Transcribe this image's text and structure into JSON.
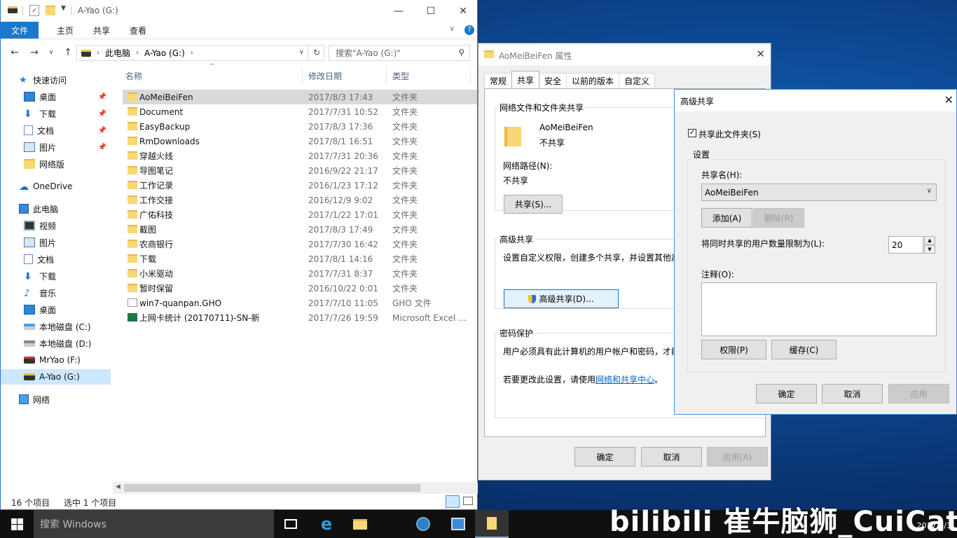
{
  "explorer": {
    "title": "A-Yao (G:)",
    "ribbon_tabs": [
      "文件",
      "主页",
      "共享",
      "查看"
    ],
    "address": {
      "pc": "此电脑",
      "drive": "A-Yao (G:)"
    },
    "search_placeholder": "搜索\"A-Yao (G:)\"",
    "columns": {
      "name": "名称",
      "date": "修改日期",
      "type": "类型"
    },
    "nav": [
      {
        "label": "快速访问",
        "icon": "star-icon",
        "pinned": false
      },
      {
        "label": "桌面",
        "icon": "desktop-icon",
        "pinned": true
      },
      {
        "label": "下载",
        "icon": "download-icon",
        "pinned": true
      },
      {
        "label": "文档",
        "icon": "document-icon",
        "pinned": true
      },
      {
        "label": "图片",
        "icon": "picture-icon",
        "pinned": true
      },
      {
        "label": "网络版",
        "icon": "folder-icon",
        "pinned": false
      },
      {
        "label": "OneDrive",
        "icon": "cloud-icon",
        "pinned": false
      },
      {
        "label": "此电脑",
        "icon": "computer-icon",
        "pinned": false
      },
      {
        "label": "视频",
        "icon": "video-icon",
        "pinned": false
      },
      {
        "label": "图片",
        "icon": "picture-icon",
        "pinned": false
      },
      {
        "label": "文档",
        "icon": "document-icon",
        "pinned": false
      },
      {
        "label": "下载",
        "icon": "download-icon",
        "pinned": false
      },
      {
        "label": "音乐",
        "icon": "music-icon",
        "pinned": false
      },
      {
        "label": "桌面",
        "icon": "desktop-icon",
        "pinned": false
      },
      {
        "label": "本地磁盘 (C:)",
        "icon": "drive-icon",
        "pinned": false
      },
      {
        "label": "本地磁盘 (D:)",
        "icon": "drive-icon",
        "pinned": false
      },
      {
        "label": "MrYao (F:)",
        "icon": "drive-icon",
        "pinned": false
      },
      {
        "label": "A-Yao (G:)",
        "icon": "drive-icon",
        "pinned": false
      },
      {
        "label": "网络",
        "icon": "network-icon",
        "pinned": false
      }
    ],
    "files": [
      {
        "name": "AoMeiBeiFen",
        "date": "2017/8/3 17:43",
        "type": "文件夹",
        "kind": "folder"
      },
      {
        "name": "Document",
        "date": "2017/7/31 10:52",
        "type": "文件夹",
        "kind": "folder"
      },
      {
        "name": "EasyBackup",
        "date": "2017/8/3 17:36",
        "type": "文件夹",
        "kind": "folder"
      },
      {
        "name": "RmDownloads",
        "date": "2017/8/1 16:51",
        "type": "文件夹",
        "kind": "folder"
      },
      {
        "name": "穿越火线",
        "date": "2017/7/31 20:36",
        "type": "文件夹",
        "kind": "folder"
      },
      {
        "name": "导图笔记",
        "date": "2016/9/22 21:17",
        "type": "文件夹",
        "kind": "folder"
      },
      {
        "name": "工作记录",
        "date": "2016/1/23 17:12",
        "type": "文件夹",
        "kind": "folder"
      },
      {
        "name": "工作交接",
        "date": "2016/12/9 9:02",
        "type": "文件夹",
        "kind": "folder"
      },
      {
        "name": "广佑科技",
        "date": "2017/1/22 17:01",
        "type": "文件夹",
        "kind": "folder"
      },
      {
        "name": "截图",
        "date": "2017/8/3 17:49",
        "type": "文件夹",
        "kind": "folder"
      },
      {
        "name": "农商银行",
        "date": "2017/7/30 16:42",
        "type": "文件夹",
        "kind": "folder"
      },
      {
        "name": "下载",
        "date": "2017/8/1 14:16",
        "type": "文件夹",
        "kind": "folder"
      },
      {
        "name": "小米驱动",
        "date": "2017/7/31 8:37",
        "type": "文件夹",
        "kind": "folder"
      },
      {
        "name": "暂时保留",
        "date": "2016/10/22 0:01",
        "type": "文件夹",
        "kind": "folder"
      },
      {
        "name": "win7-quanpan.GHO",
        "date": "2017/7/10 11:05",
        "type": "GHO 文件",
        "kind": "file"
      },
      {
        "name": "上网卡统计 (20170711)-SN-新",
        "date": "2017/7/26 19:59",
        "type": "Microsoft Excel ...",
        "kind": "xls"
      }
    ],
    "status_count": "16 个项目",
    "status_selected": "选中 1 个项目"
  },
  "props": {
    "title": "AoMeiBeiFen 属性",
    "tabs": [
      "常规",
      "共享",
      "安全",
      "以前的版本",
      "自定义"
    ],
    "net_group": "网络文件和文件夹共享",
    "folder_name": "AoMeiBeiFen",
    "share_state": "不共享",
    "net_path_label": "网络路径(N):",
    "net_path_value": "不共享",
    "share_button": "共享(S)...",
    "adv_group": "高级共享",
    "adv_desc": "设置自定义权限，创建多个共享，并设置其他高",
    "adv_button": "高级共享(D)...",
    "pwd_group": "密码保护",
    "pwd_desc": "用户必须具有此计算机的用户帐户和密码，才能",
    "pwd_change": "若要更改此设置，请使用",
    "pwd_link": "网络和共享中心",
    "pwd_end": "。",
    "ok": "确定",
    "cancel": "取消",
    "apply": "应用(A)"
  },
  "adv": {
    "title": "高级共享",
    "share_check": "共享此文件夹(S)",
    "settings_group": "设置",
    "share_name_label": "共享名(H):",
    "share_name": "AoMeiBeiFen",
    "add": "添加(A)",
    "remove": "删除(R)",
    "limit_label": "将同时共享的用户数量限制为(L):",
    "limit_value": "20",
    "comment_label": "注释(O):",
    "permissions": "权限(P)",
    "cache": "缓存(C)",
    "ok": "确定",
    "cancel": "取消",
    "apply": "应用"
  },
  "taskbar": {
    "search": "搜索 Windows",
    "clock": "2017/8/3",
    "watermark": "bilibili 崔牛脑狮_CuiCattle"
  },
  "colors": {
    "accent": "#1979ca",
    "selection": "#cce8ff",
    "row_selected": "#d9d9d9"
  }
}
